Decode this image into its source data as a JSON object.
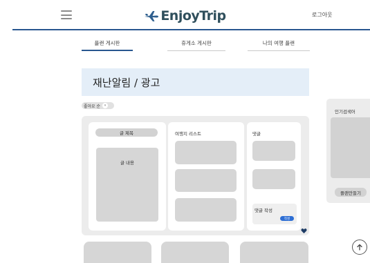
{
  "header": {
    "logo_text": "EnjoyTrip",
    "logout_label": "로그아웃",
    "accent_color": "#27568f"
  },
  "tabs": [
    {
      "label": "플랜 게시판",
      "active": true
    },
    {
      "label": "휴게소 게시판",
      "active": false
    },
    {
      "label": "나의 여행 플랜",
      "active": false
    }
  ],
  "banner": {
    "text": "재난알림 / 광고"
  },
  "like_filter": {
    "label": "좋아요 순",
    "icon": "chevron-down-icon"
  },
  "post": {
    "title_label": "글 제목",
    "content_label": "글 내용",
    "travel_list_label": "여행지 리스트",
    "comments_label": "댓글",
    "comment_write_label": "댓글 작성",
    "submit_label": "작성",
    "like_icon": "heart-icon"
  },
  "sidebar": {
    "title": "인기검색어",
    "button_label": "플랜만들기"
  },
  "scroll_top_icon": "arrow-up-circle-icon"
}
